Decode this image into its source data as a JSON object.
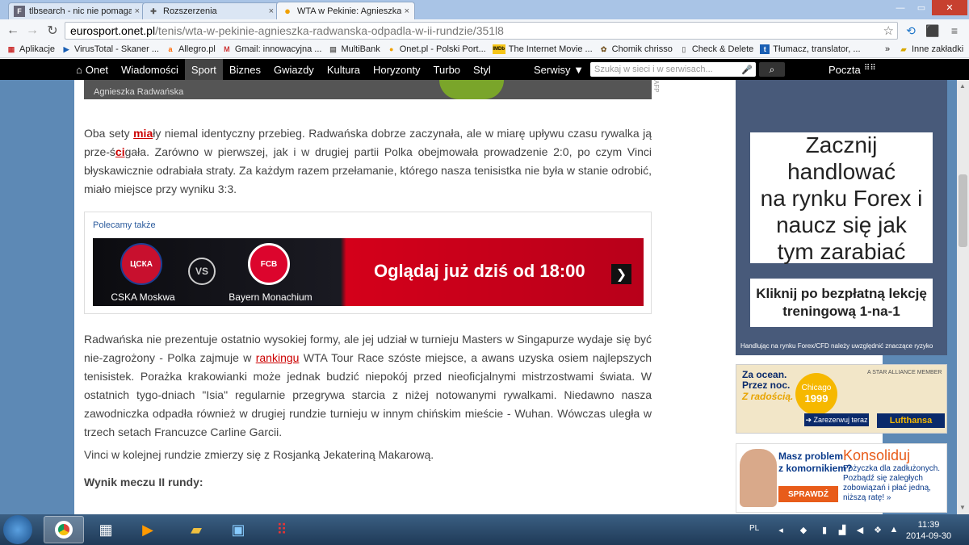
{
  "tabs": [
    {
      "favicon": "F",
      "title": "tlbsearch - nic nie pomaga",
      "close": "×"
    },
    {
      "favicon": "✚",
      "title": "Rozszerzenia",
      "close": "×"
    },
    {
      "favicon": "●",
      "title": "WTA w Pekinie: Agnieszka",
      "close": "×"
    }
  ],
  "window_controls": {
    "minimize": "—",
    "maximize": "▭",
    "close": "✕"
  },
  "toolbar": {
    "back": "←",
    "forward": "→",
    "reload": "↻",
    "star": "☆"
  },
  "address": {
    "host": "eurosport.onet.pl",
    "path": "/tenis/wta-w-pekinie-agnieszka-radwanska-odpadla-w-ii-rundzie/351l8"
  },
  "bookmarks": [
    {
      "icon": "▦",
      "label": "Aplikacje"
    },
    {
      "icon": "▶",
      "label": "VirusTotal - Skaner ..."
    },
    {
      "icon": "a",
      "label": "Allegro.pl"
    },
    {
      "icon": "M",
      "label": "Gmail: innowacyjna ..."
    },
    {
      "icon": "▤",
      "label": "MultiBank"
    },
    {
      "icon": "●",
      "label": "Onet.pl - Polski Port..."
    },
    {
      "icon": "IMDb",
      "label": "The Internet Movie ..."
    },
    {
      "icon": "✿",
      "label": "Chomik chrisso"
    },
    {
      "icon": "▯",
      "label": "Check & Delete"
    },
    {
      "icon": "t",
      "label": "Tłumacz, translator, ..."
    }
  ],
  "bookmarks_more": "»",
  "bookmarks_other": "Inne zakładki",
  "onet_nav": {
    "home": "Onet",
    "items": [
      "Wiadomości",
      "Sport",
      "Biznes",
      "Gwiazdy",
      "Kultura",
      "Horyzonty",
      "Turbo",
      "Styl"
    ],
    "active": "Sport",
    "services": "Serwisy ▼",
    "search_placeholder": "Szukaj w sieci i w serwisach...",
    "search_icon": "⌕",
    "mail": "Poczta"
  },
  "article": {
    "photo_caption": "Agnieszka Radwańska",
    "photo_credit": "AFP",
    "para1_a": "Oba sety ",
    "para1_b": "mia",
    "para1_c": "ły niemal identyczny przebieg. Radwańska dobrze zaczynała, ale w miarę upływu czasu rywalka ją prze-ś",
    "para1_d": "ci",
    "para1_e": "gała. Zarówno w pierwszej, jak i w drugiej partii Polka obejmowała prowadzenie 2:0, po czym Vinci błyskawicznie odrabiała straty. Za każdym razem przełamanie, którego nasza tenisistka nie była w stanie odrobić, miało miejsce przy wyniku 3:3.",
    "recommend_label": "Polecamy także",
    "banner": {
      "team1_logo": "ЦСКА",
      "team1": "CSKA Moskwa",
      "vs": "VS",
      "team2_logo": "FCB",
      "team2": "Bayern Monachium",
      "cta": "Oglądaj już dziś od 18:00",
      "arrow": "❯"
    },
    "para2_a": "Radwańska nie prezentuje ostatnio wysokiej formy, ale jej udział w turnieju Masters w Singapurze wydaje się być nie-zagrożony - Polka zajmuje w ",
    "para2_link": "rankingu",
    "para2_b": " WTA Tour Race szóste miejsce, a awans uzyska osiem najlepszych tenisistek. Porażka krakowianki może jednak budzić niepokój przed nieoficjalnymi mistrzostwami świata. W ostatnich tygo-dniach \"Isia\" regularnie przegrywa starcia z niżej notowanymi rywalkami. Niedawno nasza zawodniczka odpadła również w drugiej rundzie turnieju w innym chińskim mieście - Wuhan. Wówczas uległa w trzech setach Francuzce Carline Garcii.",
    "para3": "Vinci w kolejnej rundzie zmierzy się z Rosjanką Jekateriną Makarową.",
    "result_heading": "Wynik meczu II rundy:"
  },
  "ads": {
    "forex_lines": [
      "Zacznij handlować",
      "na rynku Forex i",
      "naucz się jak",
      "tym zarabiać"
    ],
    "forex_cta": "Kliknij po bezpłatną lekcję treningową 1-na-1",
    "forex_foot": "Handlując na rynku Forex/CFD należy uwzględnić znaczące ryzyko",
    "lufthansa_t1": "Za ocean.",
    "lufthansa_t2": "Przez noc.",
    "lufthansa_t3": "Z radością.",
    "lufthansa_city": "Chicago",
    "lufthansa_price": "1999",
    "lufthansa_btn": "➔ Zarezerwuj teraz",
    "lufthansa_brand": "Lufthansa",
    "lufthansa_star": "A STAR ALLIANCE MEMBER",
    "konsol_q1": "Masz problem",
    "konsol_q2": "z komornikiem?",
    "konsol_btn": "SPRAWDŹ",
    "konsol_brand": "Konsoliduj",
    "konsol_desc": "Pożyczka dla zadłużonych. Pozbądź się zaległych zobowiązań i płać jedną, niższą ratę! »"
  },
  "taskbar": {
    "lang": "PL",
    "time": "11:39",
    "date": "2014-09-30"
  }
}
